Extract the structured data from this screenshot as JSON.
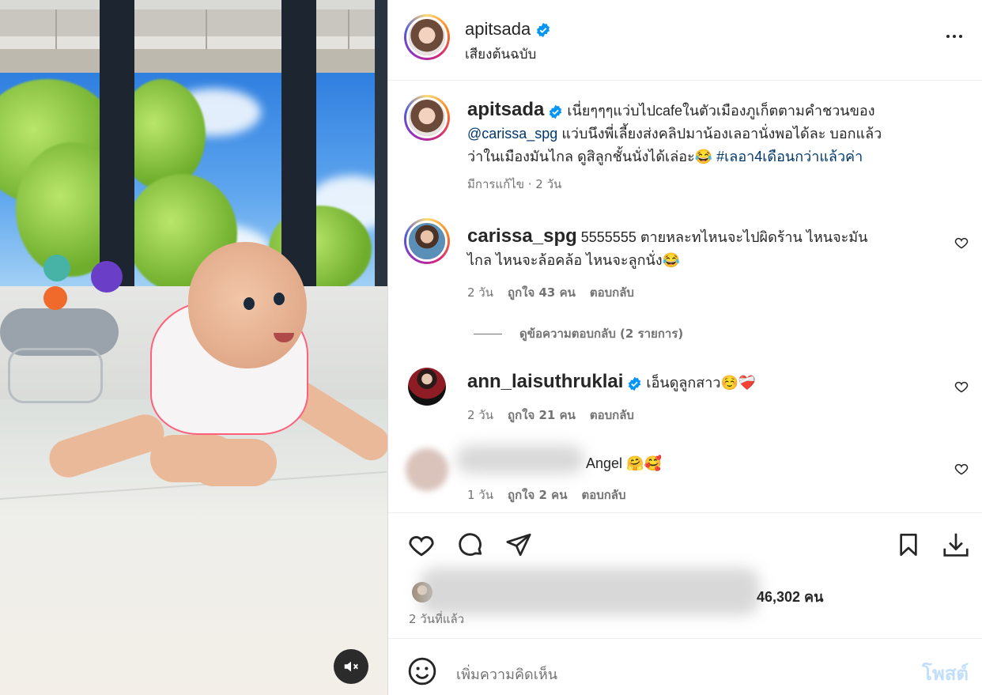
{
  "header": {
    "username": "apitsada",
    "subtitle": "เสียงต้นฉบับ",
    "more_icon": "more-horizontal-icon"
  },
  "caption": {
    "username": "apitsada",
    "line1": " เนี่ยๆๆๆแว่บไปcafeในตัวเมืองภูเก็ตตามคำชวนของ",
    "mention": "@carissa_spg",
    "line2": " แว่บนึงพี่เลี้ยงส่งคลิปมาน้องเลอานั่งพอได้ละ บอกแล้ว",
    "line3": "ว่าในเมืองมันไกล ดูสิลูกชั้นนั่งได้เล่อะ😂 ",
    "hashtag": "#เลอา4เดือนกว่าแล้วค่า",
    "meta": "มีการแก้ไข · 2 วัน"
  },
  "comments": [
    {
      "username": "carissa_spg",
      "line1": " 5555555 ตายหละทไหนจะไปผิดร้าน ไหนจะมัน",
      "line2": "ไกล ไหนจะล้อคล้อ ไหนจะลูกนั่ง😂",
      "time": "2 วัน",
      "likes": "ถูกใจ 43 คน",
      "reply": "ตอบกลับ",
      "view_replies": "ดูข้อความตอบกลับ (2 รายการ)"
    },
    {
      "username": "ann_laisuthruklai",
      "text": " เอ็นดูลูกสาว☺️❤️‍🩹",
      "time": "2 วัน",
      "likes": "ถูกใจ 21 คน",
      "reply": "ตอบกลับ"
    },
    {
      "text": "Angel 🤗🥰",
      "time": "1 วัน",
      "likes": "ถูกใจ 2 คน",
      "reply": "ตอบกลับ"
    }
  ],
  "actions": {
    "like_icon": "heart-icon",
    "comment_icon": "comment-icon",
    "share_icon": "send-icon",
    "save_icon": "bookmark-icon",
    "download_icon": "download-icon"
  },
  "likes_summary": "46,302 คน",
  "post_time": "2 วันที่แล้ว",
  "add_comment": {
    "placeholder": "เพิ่มความคิดเห็น",
    "post_label": "โพสต์",
    "emoji_icon": "emoji-icon"
  },
  "media": {
    "mute_icon": "speaker-muted-icon"
  },
  "colors": {
    "verified": "#0095f6",
    "link": "#00376b",
    "post_disabled": "#c1dffc"
  }
}
